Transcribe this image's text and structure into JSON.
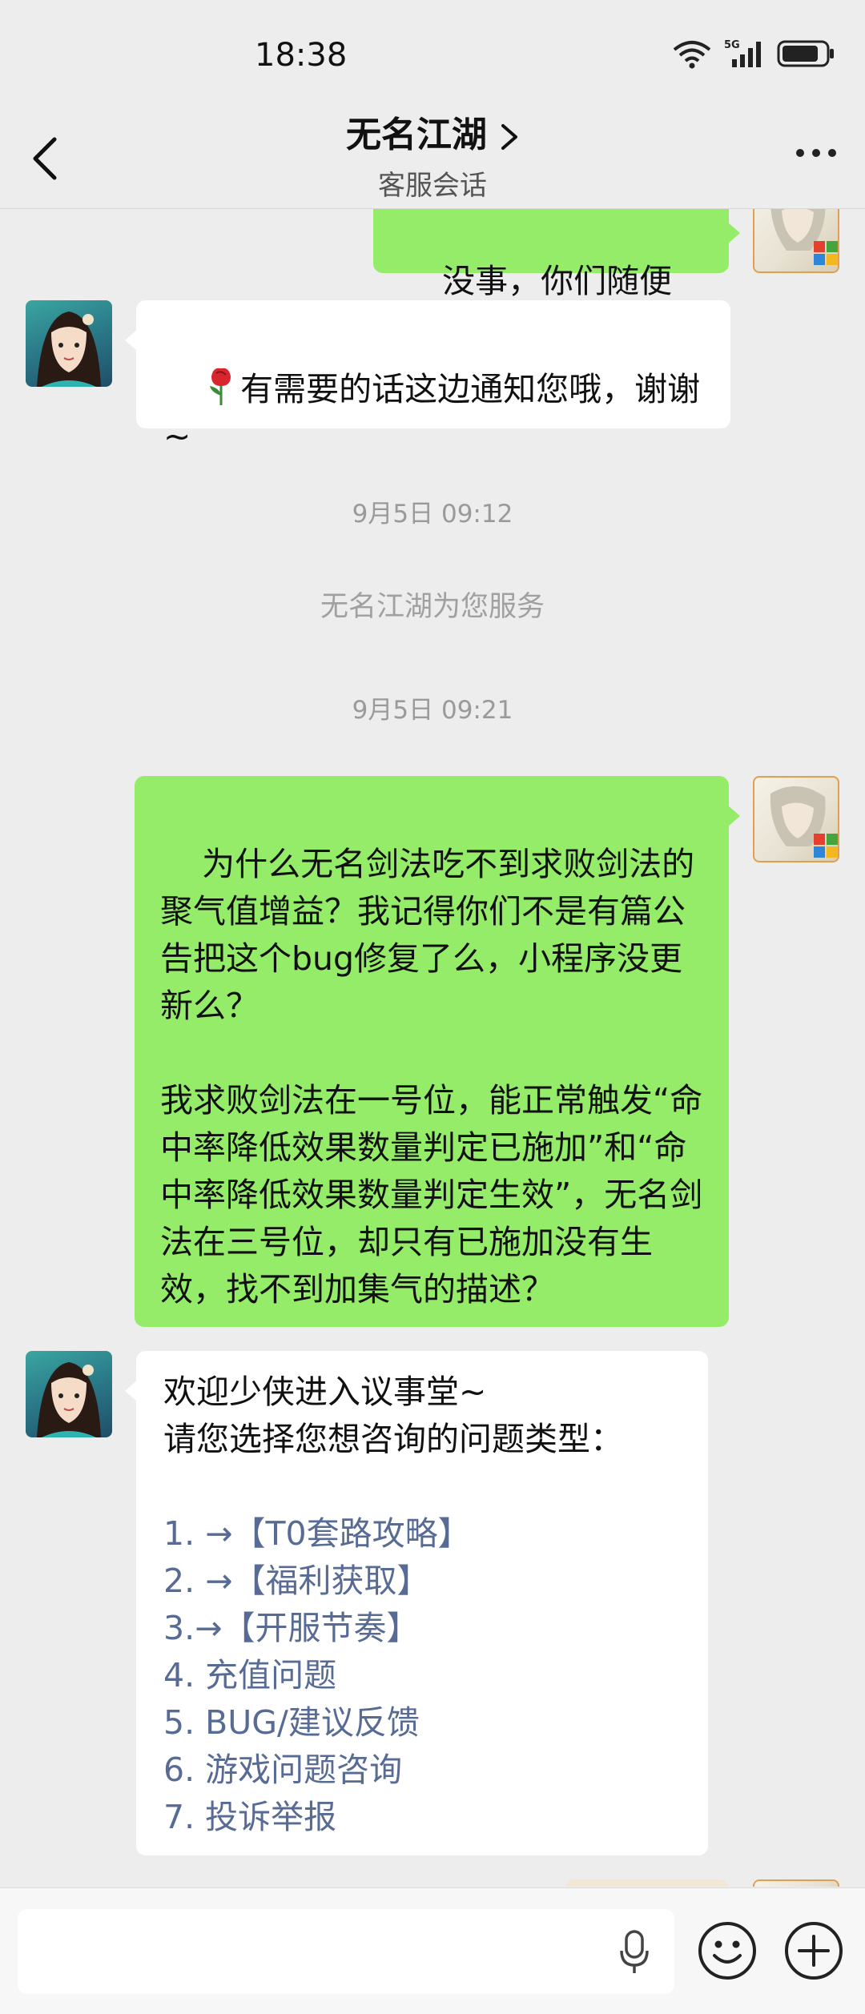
{
  "status": {
    "time": "18:38",
    "signal_label": "5G",
    "wifi_label": "6"
  },
  "header": {
    "title": "无名江湖",
    "subtitle": "客服会话"
  },
  "messages": {
    "m1": "没事，你们随便弄，",
    "m2_text": "有需要的话这边通知您哦，谢谢~",
    "ts1": "9月5日 09:12",
    "notice": "无名江湖为您服务",
    "ts2": "9月5日 09:21",
    "m3": "为什么无名剑法吃不到求败剑法的聚气值增益？我记得你们不是有篇公告把这个bug修复了么，小程序没更新么？\n\n我求败剑法在一号位，能正常触发“命中率降低效果数量判定已施加”和“命中率降低效果数量判定生效”，无名剑法在三号位，却只有已施加没有生效，找不到加集气的描述？",
    "m4_line1": "欢迎少侠进入议事堂~",
    "m4_line2": "请您选择您想咨询的问题类型：",
    "m4_items": [
      "1. →【T0套路攻略】",
      "2. →【福利获取】",
      "3.→【开服节奏】",
      "4. 充值问题",
      "5. BUG/建议反馈",
      "6. 游戏问题咨询",
      "7. 投诉举报"
    ]
  },
  "input": {
    "placeholder": ""
  },
  "colors": {
    "sent_bubble": "#95ec69",
    "received_bubble": "#ffffff",
    "link": "#576b95",
    "background": "#ededed"
  }
}
